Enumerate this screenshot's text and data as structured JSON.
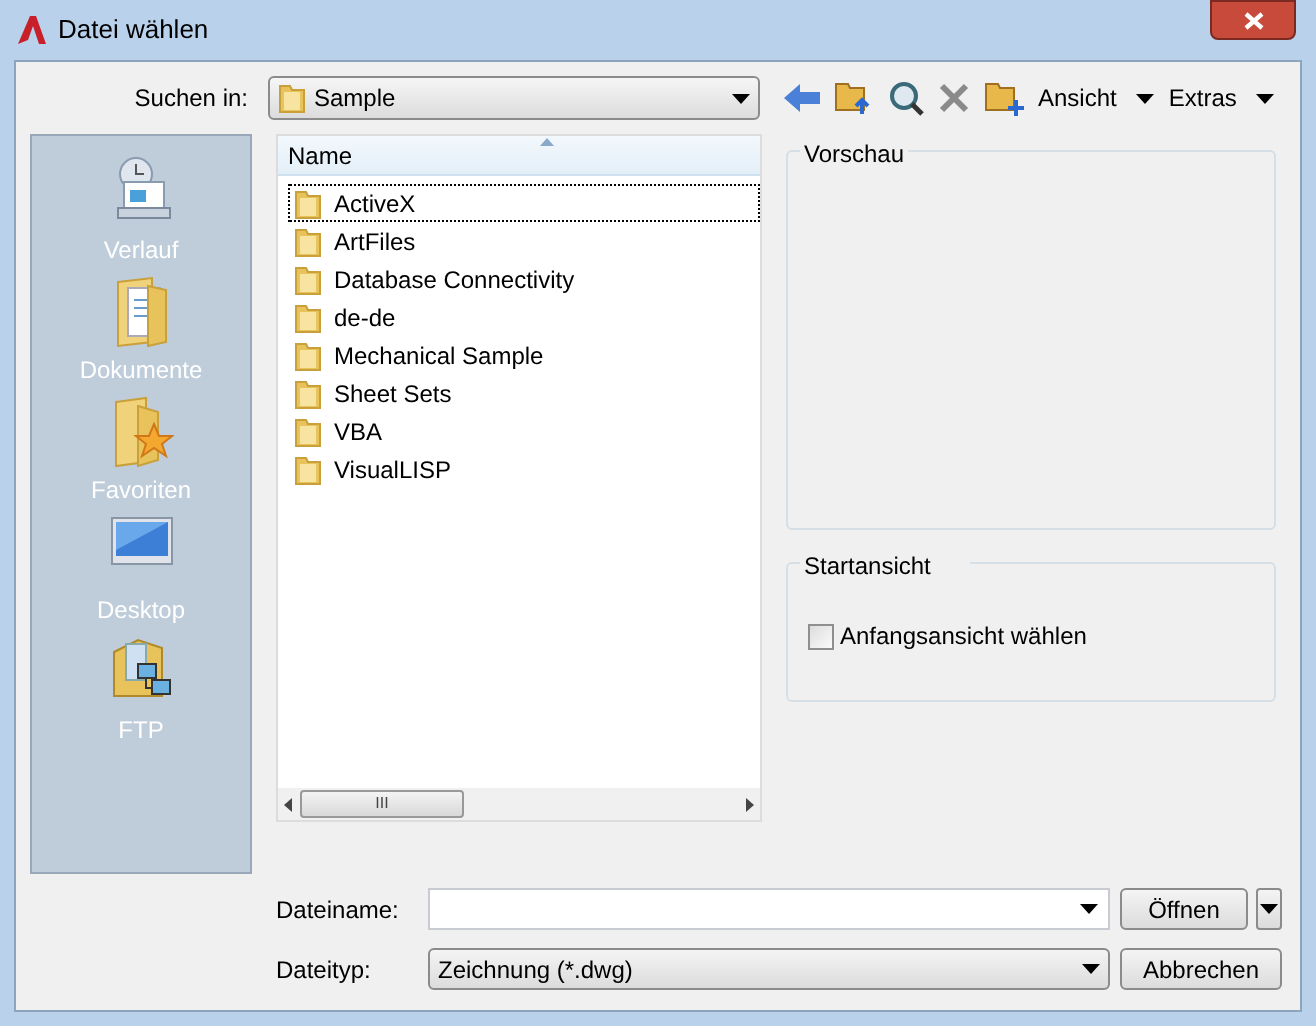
{
  "window": {
    "title": "Datei wählen"
  },
  "look_in": {
    "label": "Suchen in:",
    "value": "Sample"
  },
  "toolbar": {
    "menus": [
      {
        "label": "Ansicht"
      },
      {
        "label": "Extras"
      }
    ]
  },
  "places": [
    {
      "label": "Verlauf",
      "kind": "history"
    },
    {
      "label": "Dokumente",
      "kind": "documents"
    },
    {
      "label": "Favoriten",
      "kind": "favorites"
    },
    {
      "label": "Desktop",
      "kind": "desktop"
    },
    {
      "label": "FTP",
      "kind": "ftp"
    }
  ],
  "file_list": {
    "column": "Name",
    "rows": [
      {
        "name": "ActiveX",
        "selected": true
      },
      {
        "name": "ArtFiles",
        "selected": false
      },
      {
        "name": "Database Connectivity",
        "selected": false
      },
      {
        "name": "de-de",
        "selected": false
      },
      {
        "name": "Mechanical Sample",
        "selected": false
      },
      {
        "name": "Sheet Sets",
        "selected": false
      },
      {
        "name": "VBA",
        "selected": false
      },
      {
        "name": "VisualLISP",
        "selected": false
      }
    ],
    "scroll_text": "III"
  },
  "preview": {
    "title": "Vorschau"
  },
  "start_view": {
    "title": "Startansicht",
    "checkbox": {
      "label": "Anfangsansicht wählen",
      "checked": false
    }
  },
  "file_name": {
    "label": "Dateiname:"
  },
  "file_type": {
    "label": "Dateityp:",
    "value": "Zeichnung (*.dwg)"
  },
  "buttons": [
    {
      "label": "Öffnen"
    },
    {
      "label": "Abbrechen"
    }
  ]
}
